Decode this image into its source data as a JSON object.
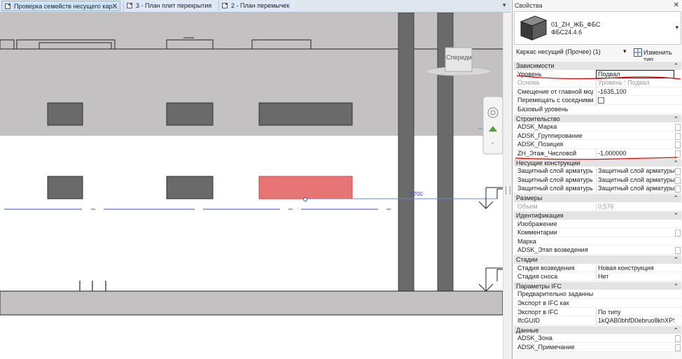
{
  "tabs": [
    {
      "label": "Проверка семейств несущего кар...",
      "close": "✕",
      "active": true
    },
    {
      "label": "3 - План плит перекрытия",
      "active": false
    },
    {
      "label": "2 - План перемычек",
      "active": false
    }
  ],
  "tab_dropdown": "▾",
  "canvas": {
    "view_cube_label": "Спереди",
    "dimension_value": "5700"
  },
  "properties": {
    "title": "Свойства",
    "close": "✕",
    "type_name_line1": "01_ZH_ЖБ_ФБС",
    "type_name_line2": "ФБС24.4.6",
    "type_arrow": "▾",
    "selector_text": "Каркас несущий (Прочее) (1)",
    "selector_arrow": "▾",
    "edit_type_label": "Изменить тип",
    "collapse_glyph": "⌃",
    "sections": [
      {
        "title": "Зависимости",
        "rows": [
          {
            "key": "Уровень",
            "value": "Подвал",
            "boxed": true
          },
          {
            "key": "Основа",
            "value": "Уровень : Подвал",
            "dim": true
          },
          {
            "key": "Смещение от главной мод...",
            "value": "-1635,100"
          },
          {
            "key": "Перемещать с соседними ...",
            "value": "",
            "checkbox": true
          },
          {
            "key": "Базовый уровень",
            "value": ""
          }
        ]
      },
      {
        "title": "Строительство",
        "rows": [
          {
            "key": "ADSK_Марка",
            "value": "",
            "rbox": true
          },
          {
            "key": "ADSK_Группирование",
            "value": "",
            "rbox": true
          },
          {
            "key": "ADSK_Позиция",
            "value": "",
            "rbox": true
          },
          {
            "key": "ZH_Этаж_Числовой",
            "value": "-1,000000",
            "rbox": true
          }
        ]
      },
      {
        "title": "Несущие конструкции",
        "rows": [
          {
            "key": "Защитный слой арматуры...",
            "value": "Защитный слой арматуры ...",
            "rbox": true
          },
          {
            "key": "Защитный слой арматуры...",
            "value": "Защитный слой арматуры ...",
            "rbox": true
          },
          {
            "key": "Защитный слой арматуры...",
            "value": "Защитный слой арматуры ...",
            "rbox": true
          }
        ]
      },
      {
        "title": "Размеры",
        "rows": [
          {
            "key": "Объем",
            "value": "0,576",
            "dim": true
          }
        ]
      },
      {
        "title": "Идентификация",
        "rows": [
          {
            "key": "Изображение",
            "value": ""
          },
          {
            "key": "Комментарии",
            "value": "",
            "rbox": true
          },
          {
            "key": "Марка",
            "value": ""
          },
          {
            "key": "ADSK_Этап возведения",
            "value": "",
            "rbox": true
          }
        ]
      },
      {
        "title": "Стадии",
        "rows": [
          {
            "key": "Стадия возведения",
            "value": "Новая конструкция"
          },
          {
            "key": "Стадия сноса",
            "value": "Нет"
          }
        ]
      },
      {
        "title": "Параметры IFC",
        "rows": [
          {
            "key": "Предварительно заданный...",
            "value": ""
          },
          {
            "key": "Экспорт в IFC как",
            "value": ""
          },
          {
            "key": "Экспорт в IFC",
            "value": "По типу"
          },
          {
            "key": "IfcGUID",
            "value": "1kQAB0bhfD0ebruo8khXPS"
          }
        ]
      },
      {
        "title": "Данные",
        "rows": [
          {
            "key": "ADSK_Зона",
            "value": "",
            "rbox": true
          },
          {
            "key": "ADSK_Примечание",
            "value": "",
            "rbox": true
          }
        ]
      }
    ]
  }
}
